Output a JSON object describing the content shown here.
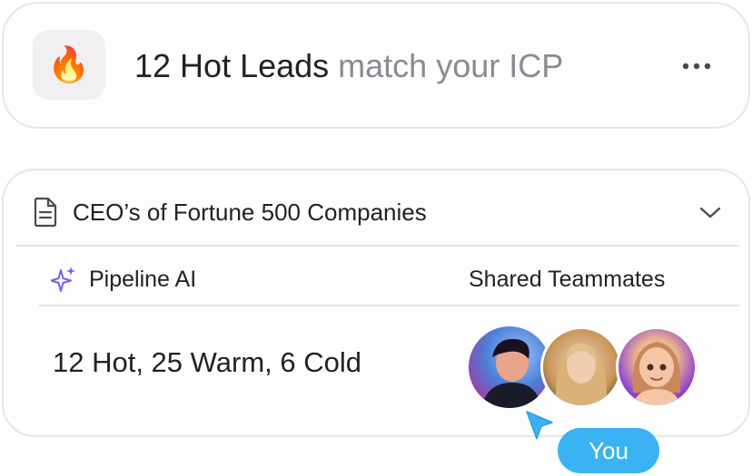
{
  "header": {
    "emoji": "🔥",
    "title_main": "12 Hot Leads",
    "title_sub": "match your ICP"
  },
  "list": {
    "title": "CEO’s of Fortune 500 Companies",
    "columns": {
      "ai_label": "Pipeline AI",
      "team_label": "Shared Teammates"
    },
    "row": {
      "summary": "12 Hot, 25 Warm, 6 Cold",
      "you_label": "You"
    }
  },
  "colors": {
    "accent_sparkle": "#7b5cf0",
    "you_pill": "#3bb2f4"
  },
  "icons": [
    "more-horizontal-icon",
    "document-icon",
    "chevron-down-icon",
    "sparkle-icon",
    "cursor-arrow-icon"
  ]
}
